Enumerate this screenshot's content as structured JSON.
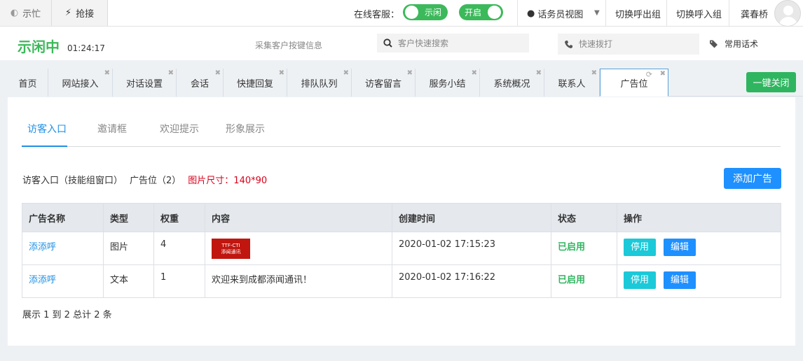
{
  "topbar": {
    "busy_label": "示忙",
    "grab_label": "抢接",
    "online_label": "在线客服：",
    "toggle_idle": "示闲",
    "toggle_on": "开启",
    "agent_view": "话务员视图",
    "switch_out": "切换呼出组",
    "switch_in": "切换呼入组",
    "username": "龚春桥"
  },
  "status": {
    "state": "示闲中",
    "timer": "01:24:17",
    "collect_link": "采集客户按键信息",
    "search_placeholder": "客户快速搜索",
    "dial_placeholder": "快速拨打",
    "phrases": "常用话术"
  },
  "tabs": [
    {
      "label": "首页"
    },
    {
      "label": "网站接入"
    },
    {
      "label": "对话设置"
    },
    {
      "label": "会话"
    },
    {
      "label": "快捷回复"
    },
    {
      "label": "排队队列"
    },
    {
      "label": "访客留言"
    },
    {
      "label": "服务小结"
    },
    {
      "label": "系统概况"
    },
    {
      "label": "联系人"
    },
    {
      "label": "广告位"
    }
  ],
  "close_all": "一键关闭",
  "subtabs": [
    "访客入口",
    "邀请框",
    "欢迎提示",
    "形象展示"
  ],
  "info": {
    "entry": "访客入口（技能组窗口）",
    "slot": "广告位（2）",
    "size": "图片尺寸：140*90"
  },
  "add_ad": "添加广告",
  "table": {
    "headers": [
      "广告名称",
      "类型",
      "权重",
      "内容",
      "创建时间",
      "状态",
      "操作"
    ],
    "rows": [
      {
        "name": "添添呼",
        "type": "图片",
        "weight": "4",
        "content_line1": "TTF-CTI",
        "content_line2": "添闻通讯",
        "created": "2020-01-02 17:15:23",
        "status": "已启用",
        "stop": "停用",
        "edit": "编辑"
      },
      {
        "name": "添添呼",
        "type": "文本",
        "weight": "1",
        "content": "欢迎来到成都添闻通讯！",
        "created": "2020-01-02 17:16:22",
        "status": "已启用",
        "stop": "停用",
        "edit": "编辑"
      }
    ]
  },
  "footer": "展示 1 到 2 总计 2 条"
}
